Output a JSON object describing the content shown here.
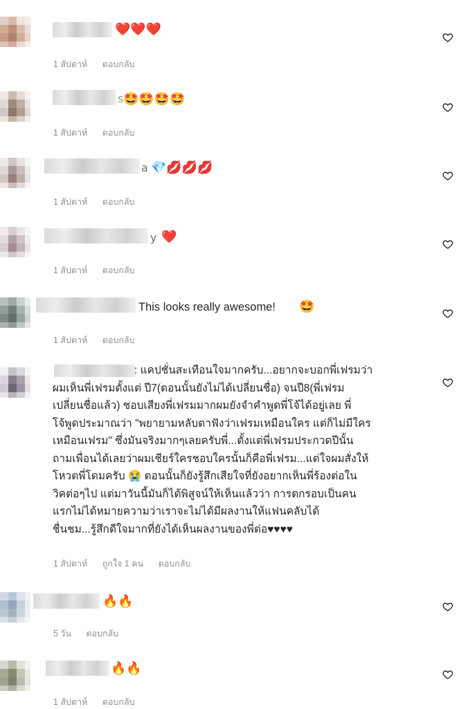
{
  "comments": [
    {
      "text": "",
      "emojis": "❤️❤️❤️",
      "time": "1 สัปดาห์",
      "likes": "",
      "reply": "ตอบกลับ"
    },
    {
      "text": "s",
      "emojis": "🤩🤩🤩🤩",
      "time": "1 สัปดาห์",
      "likes": "",
      "reply": "ตอบกลับ"
    },
    {
      "text": "a",
      "emojis": "💎💋💋💋",
      "time": "1 สัปดาห์",
      "likes": "",
      "reply": "ตอบกลับ"
    },
    {
      "text": "y",
      "emojis": "❤️",
      "time": "1 สัปดาห์",
      "likes": "",
      "reply": "ตอบกลับ"
    },
    {
      "text": "This looks really awesome!",
      "emojis": "🤩",
      "time": "1 สัปดาห์",
      "likes": "",
      "reply": "ตอบกลับ"
    },
    {
      "text": "",
      "emojis": "",
      "time": "1 สัปดาห์",
      "likes": "ถูกใจ 1 คน",
      "reply": "ตอบกลับ",
      "lines": [
        ": แคปชั่นสะเทือนใจมากครับ...อยากจะบอกพี่เฟรมว่า",
        "ผมเห็นพี่เฟรมตั้งแต่ ปี7(ตอนนั้นยังไม่ได้เปลี่ยนชื่อ) จนปี8(พี่เฟรม",
        "เปลี่ยนชื่อแล้ว) ชอบเสียงพี่เฟรมมากผมยังจำคำพูดพี่โจ้ได้อยู่เลย พี่",
        "โจ้พูดประมาณว่า \"พยายามหลับตาฟังว่าเฟรมเหมือนใคร แต่ก็ไม่มีใคร",
        "เหมือนเฟรม\" ซึ่งมันจริงมากๆเลยครับพี่...ตั้งแต่พี่เฟรมประกวดปีนั้น",
        "ถามเพื่อนได้เลยว่าผมเชียร์ใครชอบใครนั้นก็คือพี่เฟรม...แต่ใจผมสั่งให้",
        "โหวตพี่โดมครับ 😭 ตอนนั้นก็ยังรู้สึกเสียใจที่ยังอยากเห็นพี่ร้องต่อใน",
        "วิคต่อๆไป แต่มาวันนี้มันก็ได้พิสูจน์ให้เห็นแล้วว่า การตกรอบเป็นคน",
        "แรกไม่ได้หมายความว่าเราจะไม่ได้มีผลงานให้แฟนคลับได้",
        "ชื่นชม...รู้สึกดีใจมากที่ยังได้เห็นผลงานของพี่ต่อ♥♥♥♥"
      ]
    },
    {
      "text": "",
      "emojis": "🔥🔥",
      "time": "5 วัน",
      "likes": "",
      "reply": "ตอบกลับ"
    },
    {
      "text": "",
      "emojis": "🔥🔥",
      "time": "1 สัปดาห์",
      "likes": "",
      "reply": "ตอบกลับ"
    }
  ],
  "colors": {
    "meta": "#8e8e8e",
    "text": "#262626",
    "heart_outline": "#262626"
  },
  "icons": {
    "like": "heart-outline-icon"
  }
}
